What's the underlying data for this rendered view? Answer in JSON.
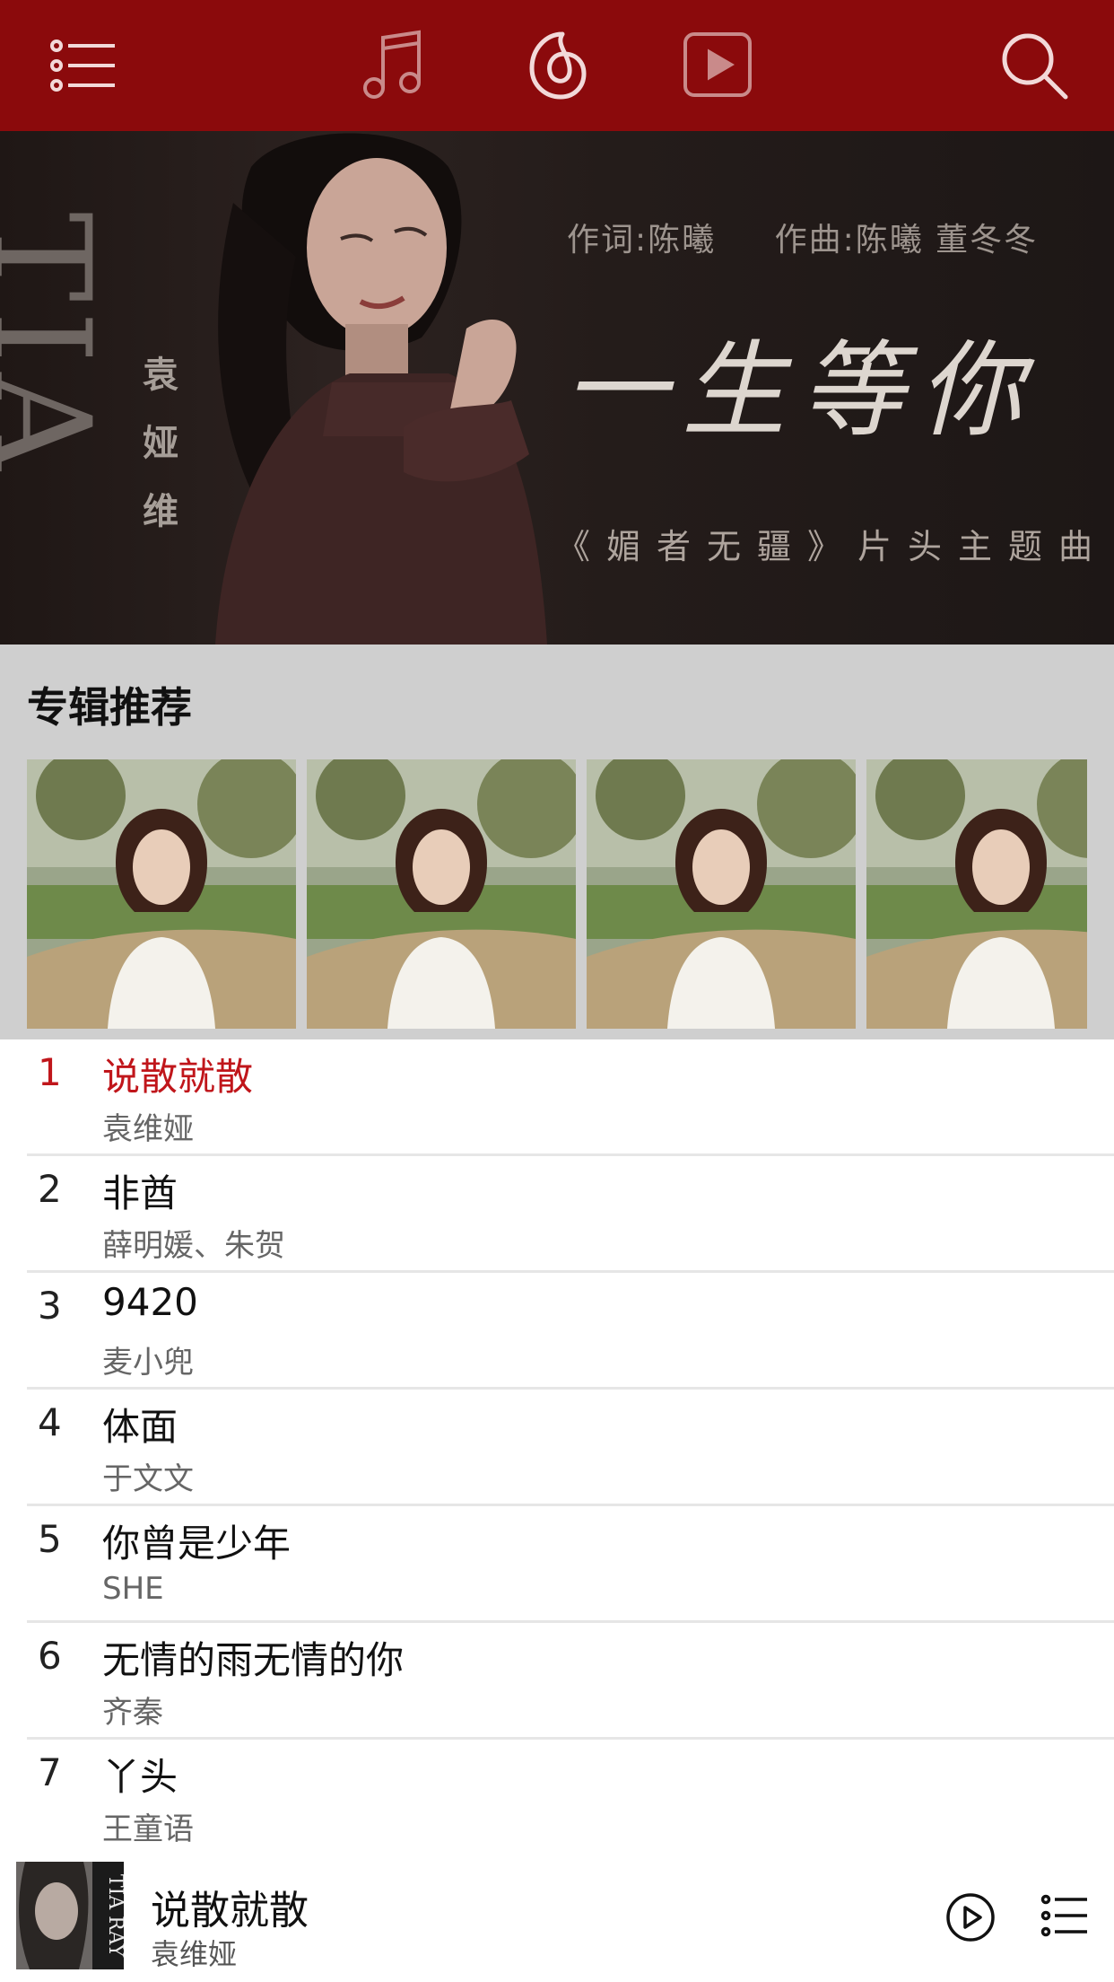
{
  "colors": {
    "brand": "#8b0a0c",
    "accent": "#c0161b",
    "album_section_bg": "#cfcfcf"
  },
  "topbar": {
    "icons": [
      "menu-icon",
      "music-note-icon",
      "netease-music-logo-icon",
      "video-play-icon",
      "search-icon"
    ]
  },
  "banner": {
    "latin_text": "TIA",
    "artist_vertical": "袁娅维",
    "lyricist": "作词:陈曦",
    "composer": "作曲:陈曦  董冬冬",
    "title": "一生等你",
    "subtitle": "《媚者无疆》片头主题曲",
    "carousel_total": 4,
    "carousel_active": 1
  },
  "albums": {
    "section_title": "专辑推荐",
    "count": 4
  },
  "songs": [
    {
      "rank": "1",
      "title": "说散就散",
      "artist": "袁维娅",
      "active": true
    },
    {
      "rank": "2",
      "title": "非酋",
      "artist": "薛明媛、朱贺"
    },
    {
      "rank": "3",
      "title": "9420",
      "artist": "麦小兜"
    },
    {
      "rank": "4",
      "title": "体面",
      "artist": "于文文"
    },
    {
      "rank": "5",
      "title": "你曾是少年",
      "artist": "SHE"
    },
    {
      "rank": "6",
      "title": "无情的雨无情的你",
      "artist": "齐秦"
    },
    {
      "rank": "7",
      "title": "丫头",
      "artist": "王童语"
    }
  ],
  "player": {
    "title": "说散就散",
    "artist": "袁维娅",
    "cover_text": "TIA RAY",
    "icons": [
      "play-icon",
      "playlist-icon"
    ]
  }
}
